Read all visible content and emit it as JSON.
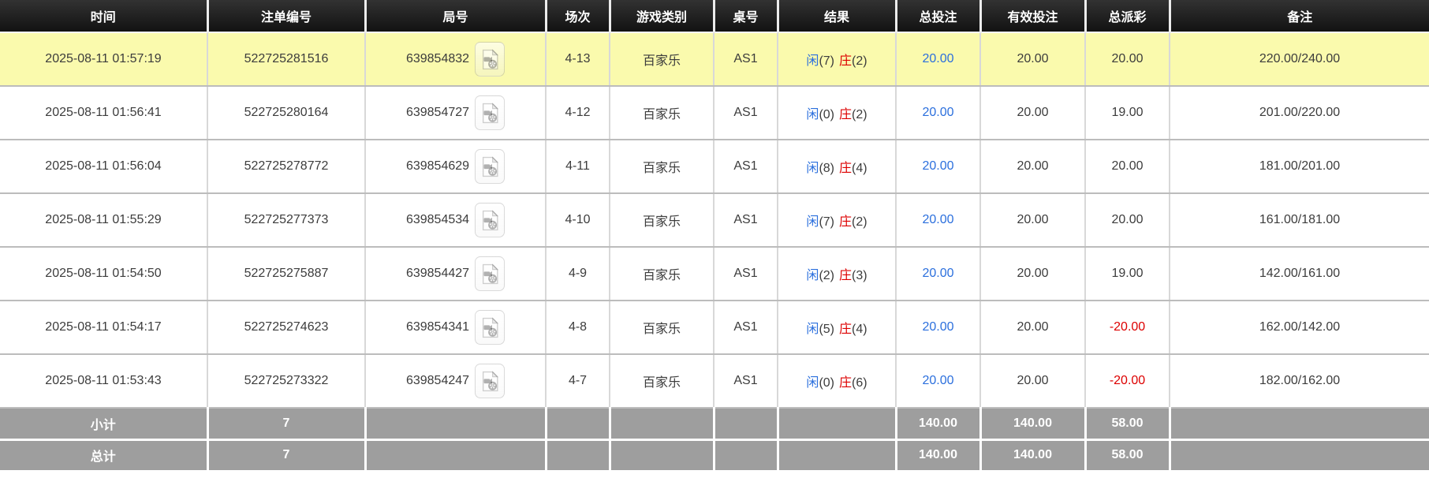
{
  "table": {
    "headers": [
      "时间",
      "注单编号",
      "局号",
      "场次",
      "游戏类别",
      "桌号",
      "结果",
      "总投注",
      "有效投注",
      "总派彩",
      "备注"
    ],
    "rows": [
      {
        "time": "2025-08-11 01:57:19",
        "bet_id": "522725281516",
        "round_id": "639854832",
        "session": "4-13",
        "game_type": "百家乐",
        "table_no": "AS1",
        "result": {
          "player_label": "闲",
          "player_points": "(7)",
          "banker_label": "庄",
          "banker_points": "(2)"
        },
        "total_bet": "20.00",
        "valid_bet": "20.00",
        "total_payout": "20.00",
        "payout_negative": false,
        "remark": "220.00/240.00",
        "highlighted": true
      },
      {
        "time": "2025-08-11 01:56:41",
        "bet_id": "522725280164",
        "round_id": "639854727",
        "session": "4-12",
        "game_type": "百家乐",
        "table_no": "AS1",
        "result": {
          "player_label": "闲",
          "player_points": "(0)",
          "banker_label": "庄",
          "banker_points": "(2)"
        },
        "total_bet": "20.00",
        "valid_bet": "20.00",
        "total_payout": "19.00",
        "payout_negative": false,
        "remark": "201.00/220.00",
        "highlighted": false
      },
      {
        "time": "2025-08-11 01:56:04",
        "bet_id": "522725278772",
        "round_id": "639854629",
        "session": "4-11",
        "game_type": "百家乐",
        "table_no": "AS1",
        "result": {
          "player_label": "闲",
          "player_points": "(8)",
          "banker_label": "庄",
          "banker_points": "(4)"
        },
        "total_bet": "20.00",
        "valid_bet": "20.00",
        "total_payout": "20.00",
        "payout_negative": false,
        "remark": "181.00/201.00",
        "highlighted": false
      },
      {
        "time": "2025-08-11 01:55:29",
        "bet_id": "522725277373",
        "round_id": "639854534",
        "session": "4-10",
        "game_type": "百家乐",
        "table_no": "AS1",
        "result": {
          "player_label": "闲",
          "player_points": "(7)",
          "banker_label": "庄",
          "banker_points": "(2)"
        },
        "total_bet": "20.00",
        "valid_bet": "20.00",
        "total_payout": "20.00",
        "payout_negative": false,
        "remark": "161.00/181.00",
        "highlighted": false
      },
      {
        "time": "2025-08-11 01:54:50",
        "bet_id": "522725275887",
        "round_id": "639854427",
        "session": "4-9",
        "game_type": "百家乐",
        "table_no": "AS1",
        "result": {
          "player_label": "闲",
          "player_points": "(2)",
          "banker_label": "庄",
          "banker_points": "(3)"
        },
        "total_bet": "20.00",
        "valid_bet": "20.00",
        "total_payout": "19.00",
        "payout_negative": false,
        "remark": "142.00/161.00",
        "highlighted": false
      },
      {
        "time": "2025-08-11 01:54:17",
        "bet_id": "522725274623",
        "round_id": "639854341",
        "session": "4-8",
        "game_type": "百家乐",
        "table_no": "AS1",
        "result": {
          "player_label": "闲",
          "player_points": "(5)",
          "banker_label": "庄",
          "banker_points": "(4)"
        },
        "total_bet": "20.00",
        "valid_bet": "20.00",
        "total_payout": "-20.00",
        "payout_negative": true,
        "remark": "162.00/142.00",
        "highlighted": false
      },
      {
        "time": "2025-08-11 01:53:43",
        "bet_id": "522725273322",
        "round_id": "639854247",
        "session": "4-7",
        "game_type": "百家乐",
        "table_no": "AS1",
        "result": {
          "player_label": "闲",
          "player_points": "(0)",
          "banker_label": "庄",
          "banker_points": "(6)"
        },
        "total_bet": "20.00",
        "valid_bet": "20.00",
        "total_payout": "-20.00",
        "payout_negative": true,
        "remark": "182.00/162.00",
        "highlighted": false
      }
    ],
    "summary_rows": [
      {
        "label": "小计",
        "count": "7",
        "total_bet": "140.00",
        "valid_bet": "140.00",
        "total_payout": "58.00",
        "remark": ""
      },
      {
        "label": "总计",
        "count": "7",
        "total_bet": "140.00",
        "valid_bet": "140.00",
        "total_payout": "58.00",
        "remark": ""
      }
    ]
  },
  "icons": {
    "video_replay": "video-replay-icon"
  },
  "colors": {
    "accent_blue": "#2b6fdd",
    "accent_red": "#dd0000",
    "highlight_row": "#fafaad",
    "header_bg": "#1c1c1c",
    "summary_bg": "#9e9e9e"
  }
}
